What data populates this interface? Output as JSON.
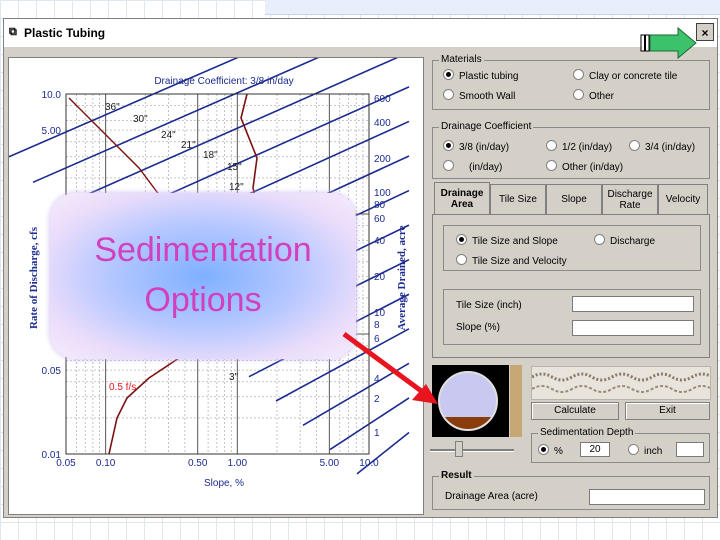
{
  "window": {
    "title": "Plastic Tubing",
    "close_label": "×"
  },
  "chart_data": {
    "type": "line",
    "title": "Drainage Coefficient: 3/8 in/day",
    "xlabel": "Slope, %",
    "ylabel_left": "Rate of Discharge, cfs",
    "ylabel_right": "Average Drained, acre",
    "x_ticks": [
      "0.05",
      "0.10",
      "0.50",
      "1.00",
      "5.00",
      "10.0"
    ],
    "y_ticks_left": [
      "10.0",
      "5.00",
      "0.05",
      "0.01"
    ],
    "y_ticks_right": [
      "600",
      "400",
      "200",
      "100",
      "80",
      "60",
      "40",
      "20",
      "10",
      "8",
      "6",
      "4",
      "2",
      "1"
    ],
    "pipe_labels": [
      "36\"",
      "30\"",
      "24\"",
      "21\"",
      "18\"",
      "15\"",
      "12\"",
      "3\""
    ],
    "annotation": "0.5 f/s",
    "grid": true
  },
  "overlay": {
    "line1": "Sedimentation",
    "line2": "Options"
  },
  "materials": {
    "title": "Materials",
    "options": [
      "Plastic tubing",
      "Clay or concrete tile",
      "Smooth Wall",
      "Other"
    ],
    "selected": 0
  },
  "drainage_coefficient": {
    "title": "Drainage Coefficient",
    "options": [
      "3/8 (in/day)",
      "1/2 (in/day)",
      "3/4 (in/day)",
      "(in/day)",
      "Other (in/day)"
    ],
    "selected": 0
  },
  "tabs": [
    "Drainage Area",
    "Tile Size",
    "Slope",
    "Discharge Rate",
    "Velocity"
  ],
  "active_tab": 0,
  "tab_panel": {
    "options": [
      "Tile Size and Slope",
      "Discharge",
      "Tile Size and Velocity"
    ],
    "selected": 0,
    "tile_size_label": "Tile Size (inch)",
    "slope_label": "Slope (%)",
    "tile_size_value": "",
    "slope_value": ""
  },
  "buttons": {
    "calculate": "Calculate",
    "exit": "Exit"
  },
  "sedimentation": {
    "title": "Sedimentation Depth",
    "percent_label": "%",
    "percent_value": "20",
    "inch_label": "inch",
    "inch_value": "",
    "selected": "percent"
  },
  "result": {
    "title": "Result",
    "label": "Drainage Area (acre)",
    "value": ""
  },
  "colors": {
    "chart_line": "#1c2b8f",
    "pipe_curve": "#7b1010",
    "overlay_text": "#d23fbf",
    "arrow": "#e8141e",
    "nav_arrow": "#3cc26a"
  }
}
